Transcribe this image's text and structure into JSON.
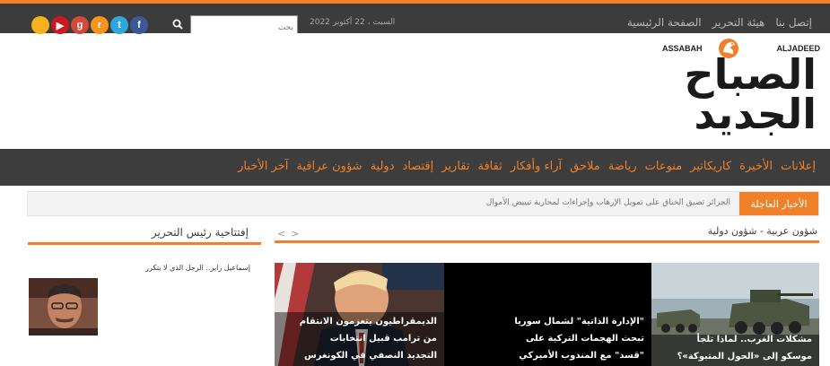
{
  "top_nav": {
    "items": [
      "الصفحة الرئيسية",
      "هيئة التحرير",
      "إتصل بنا"
    ],
    "date": "السبت ، 22 أكتوبر 2022",
    "search_placeholder": "بحث",
    "social": [
      {
        "icon": "facebook-icon",
        "glyph": "f",
        "color": "#3b5998"
      },
      {
        "icon": "twitter-icon",
        "glyph": "t",
        "color": "#2da7e0"
      },
      {
        "icon": "rss-icon",
        "glyph": "r",
        "color": "#f7941e"
      },
      {
        "icon": "google-plus-icon",
        "glyph": "g",
        "color": "#d34836"
      },
      {
        "icon": "youtube-icon",
        "glyph": "▶",
        "color": "#cc181e"
      },
      {
        "icon": "extra-icon",
        "glyph": "",
        "color": "#f5b21e"
      }
    ]
  },
  "logo": {
    "en_left": "ASSABAH",
    "en_right": "ALJADEED",
    "ar_line1": "الصباح",
    "ar_line2": "الجديد"
  },
  "main_nav": {
    "items": [
      "آخر الأخبار",
      "شؤون عراقية",
      "دولية",
      "إقتصاد",
      "تقارير",
      "ثقافة",
      "آراء وأفكار",
      "ملاحق",
      "رياضة",
      "منوعات",
      "كاريكاتير",
      "الأخيرة",
      "إعلانات"
    ]
  },
  "breaking": {
    "label": "الأخبار العاجلة",
    "text": "الجزائر تصيق الخناق على تمويل الإرهاب وإجراءات لمحاربة تبييض الأموال"
  },
  "section": {
    "title": "شؤون عربية - شؤون دولية"
  },
  "sidebar": {
    "title": "إفتتاحية رئيس التحرير",
    "author_line": "إسماعيل زاير.. الرجل الذي لا يتكرر"
  },
  "features": [
    {
      "lines": [
        "الديمقراطيون يتعزمون الانتقام",
        "من ترامب قبيل انتخابات",
        "التجديد النصفي في الكونغرس"
      ]
    },
    {
      "lines": [
        "\"الإدارة الذاتية\" لشمال سوريا",
        "تبحث الهجمات التركية على",
        "\"قسد\" مع المندوب الأميركي"
      ]
    },
    {
      "lines": [
        "مشكلات الغرب.. لماذا تلجأ",
        "موسكو إلى «الحول المتبوكة»؟"
      ]
    }
  ],
  "colors": {
    "accent": "#f0812a",
    "dark_bar": "#3c3c3c"
  }
}
